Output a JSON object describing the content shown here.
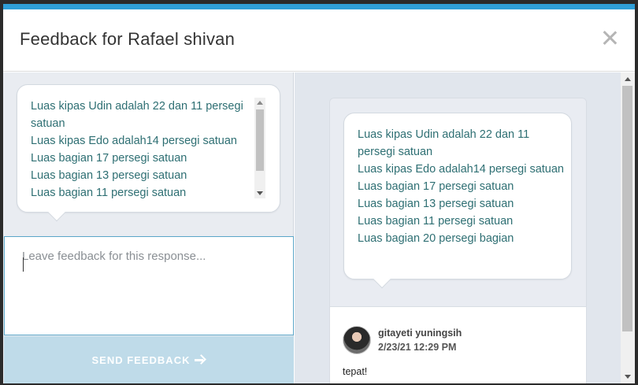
{
  "modal": {
    "title": "Feedback for Rafael shivan"
  },
  "response": {
    "lines": [
      "Luas kipas Udin adalah 22 dan 11 persegi satuan",
      "Luas kipas Edo adalah14 persegi satuan",
      "Luas bagian 17 persegi satuan",
      "Luas bagian  13 persegi satuan",
      "Luas bagian  11 persegi satuan",
      "Luas bagian 20 persegi bagian"
    ]
  },
  "feedback": {
    "placeholder": "Leave feedback for this response...",
    "value": "",
    "send_label": "SEND FEEDBACK"
  },
  "comment": {
    "author": "gitayeti yuningsih",
    "date": "2/23/21 12:29 PM",
    "text": "tepat!"
  },
  "colors": {
    "accent": "#2f9fd8",
    "response_text": "#2e6f73",
    "send_button_bg": "#bfdbe9"
  },
  "icons": {
    "close": "close-icon",
    "send_arrow": "arrow-right-icon",
    "avatar": "avatar"
  }
}
